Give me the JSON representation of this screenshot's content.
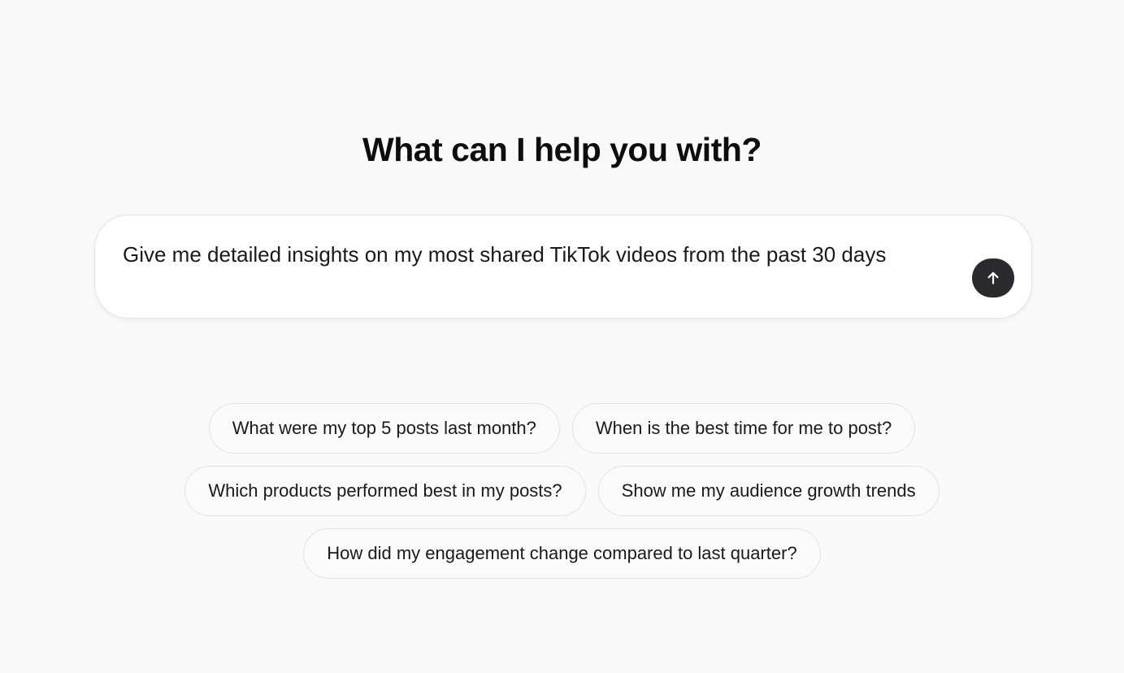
{
  "heading": "What can I help you with?",
  "composer": {
    "value": "Give me detailed insights on my most shared TikTok videos from the past 30 days",
    "send_icon": "arrow-up-icon",
    "send_bg": "#2b2b2d"
  },
  "suggestions": {
    "row1": [
      "What were my top 5 posts last month?",
      "When is the best time for me to post?"
    ],
    "row2": [
      "Which products performed best in my posts?",
      "Show me my audience growth trends"
    ],
    "row3": [
      "How did my engagement change compared to last quarter?"
    ]
  }
}
